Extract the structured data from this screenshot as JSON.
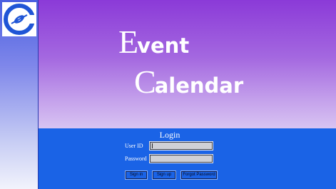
{
  "app": {
    "logo_icon": "event-calendar-logo-icon",
    "title_line1_initial": "E",
    "title_line1_rest": "vent",
    "title_line2_initial": "C",
    "title_line2_rest": "alendar"
  },
  "login": {
    "heading": "Login",
    "user_id_label": "User ID",
    "user_id_value": "",
    "password_label": "Password",
    "password_value": "",
    "sign_in_label": "Sign in",
    "sign_up_label": "Sign up",
    "forgot_password_label": "Forgot Password"
  },
  "colors": {
    "sidebar_top": "#4a5fe0",
    "hero_top": "#8b3ad8",
    "hero_bottom": "#d8c4f2",
    "login_panel": "#1a63e6",
    "logo_blue": "#1f55d6"
  }
}
